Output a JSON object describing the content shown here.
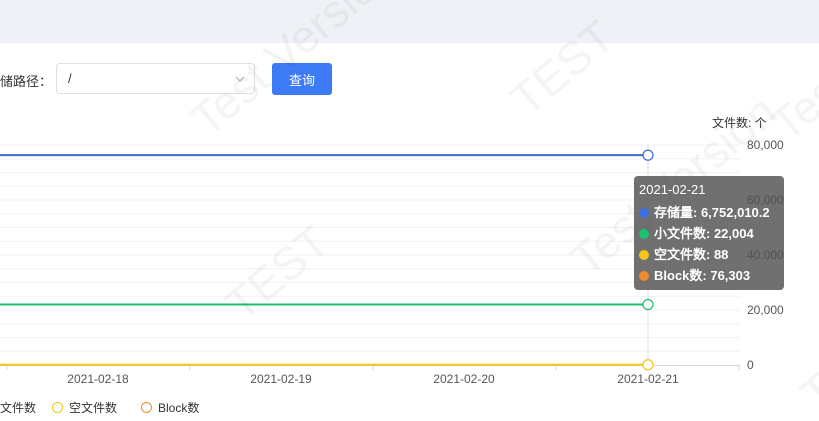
{
  "filter": {
    "label": "储路径：",
    "path_value": "/",
    "query_label": "查询"
  },
  "watermarks": [
    "Test Version",
    "TEST",
    "Test Version",
    "TEST",
    "Test Version",
    "TEST"
  ],
  "chart_data": {
    "type": "line",
    "categories": [
      "2021-02-18",
      "2021-02-19",
      "2021-02-20",
      "2021-02-21"
    ],
    "right_axis_title": "文件数: 个",
    "right_axis_ticks": [
      "80,000",
      "60,000",
      "40,000",
      "20,000",
      "0"
    ],
    "ylim": [
      0,
      80000
    ],
    "series": [
      {
        "name": "存储量",
        "color": "#3d6fe0",
        "values": [
          76300,
          76300,
          76300,
          76300
        ]
      },
      {
        "name": "小文件数",
        "color": "#19c36b",
        "values": [
          22000,
          22004,
          22004,
          22004
        ]
      },
      {
        "name": "空文件数",
        "color": "#f5c518",
        "values": [
          88,
          88,
          88,
          88
        ]
      },
      {
        "name": "Block数",
        "color": "#ee8b2e",
        "values": [
          76303,
          76303,
          76303,
          76303
        ]
      }
    ],
    "legend": [
      "文件数",
      "空文件数",
      "Block数"
    ]
  },
  "tooltip": {
    "date": "2021-02-21",
    "rows": [
      {
        "text": "存储量: 6,752,010.2",
        "color": "#3d6fe0"
      },
      {
        "text": "小文件数: 22,004",
        "color": "#19c36b"
      },
      {
        "text": "空文件数: 88",
        "color": "#f5c518"
      },
      {
        "text": "Block数: 76,303",
        "color": "#ee8b2e"
      }
    ]
  },
  "legend_items": [
    {
      "label": "文件数",
      "color": "#19c36b"
    },
    {
      "label": "空文件数",
      "color": "#f5c518"
    },
    {
      "label": "Block数",
      "color": "#ee8b2e"
    }
  ]
}
